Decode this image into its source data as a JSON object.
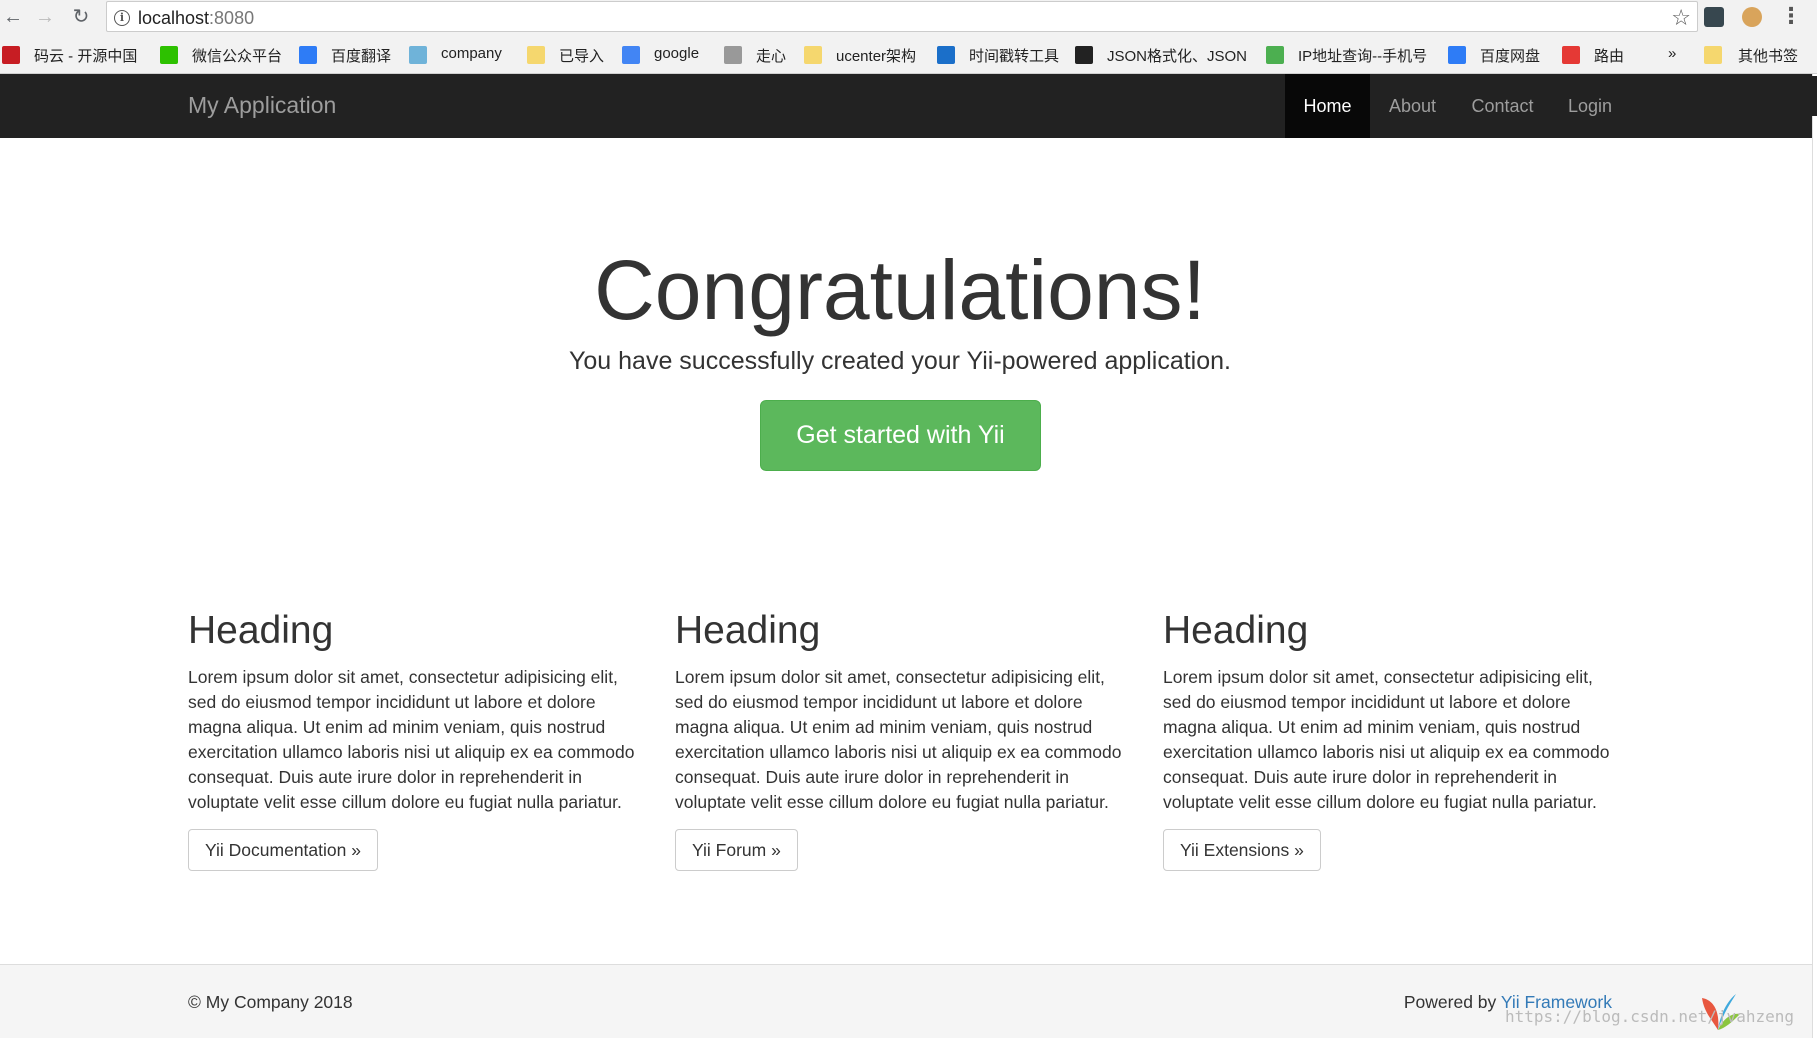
{
  "browser": {
    "url_host": "localhost",
    "url_port": ":8080",
    "bookmarks": [
      {
        "label": "码云 - 开源中国",
        "color": "#c71d23"
      },
      {
        "label": "微信公众平台",
        "color": "#2dc100"
      },
      {
        "label": "百度翻译",
        "color": "#2e7cf6"
      },
      {
        "label": "company",
        "color": "#6fb3d9"
      },
      {
        "label": "已导入",
        "color": "#f5d76e"
      },
      {
        "label": "google",
        "color": "#4285f4"
      },
      {
        "label": "走心",
        "color": "#999999"
      },
      {
        "label": "ucenter架构",
        "color": "#f5d76e"
      },
      {
        "label": "时间戳转工具",
        "color": "#1b6fc9"
      },
      {
        "label": "JSON格式化、JSON",
        "color": "#222222"
      },
      {
        "label": "IP地址查询--手机号",
        "color": "#4caf50"
      },
      {
        "label": "百度网盘",
        "color": "#2e7cf6"
      },
      {
        "label": "路由",
        "color": "#e53935"
      }
    ],
    "overflow_label": "»",
    "other_bookmarks": "其他书签"
  },
  "navbar": {
    "brand": "My Application",
    "links": [
      {
        "label": "Home",
        "active": true
      },
      {
        "label": "About",
        "active": false
      },
      {
        "label": "Contact",
        "active": false
      },
      {
        "label": "Login",
        "active": false
      }
    ]
  },
  "jumbotron": {
    "title": "Congratulations!",
    "lead": "You have successfully created your Yii-powered application.",
    "button": "Get started with Yii"
  },
  "columns": [
    {
      "heading": "Heading",
      "body": "Lorem ipsum dolor sit amet, consectetur adipisicing elit, sed do eiusmod tempor incididunt ut labore et dolore magna aliqua. Ut enim ad minim veniam, quis nostrud exercitation ullamco laboris nisi ut aliquip ex ea commodo consequat. Duis aute irure dolor in reprehenderit in voluptate velit esse cillum dolore eu fugiat nulla pariatur.",
      "button": "Yii Documentation »"
    },
    {
      "heading": "Heading",
      "body": "Lorem ipsum dolor sit amet, consectetur adipisicing elit, sed do eiusmod tempor incididunt ut labore et dolore magna aliqua. Ut enim ad minim veniam, quis nostrud exercitation ullamco laboris nisi ut aliquip ex ea commodo consequat. Duis aute irure dolor in reprehenderit in voluptate velit esse cillum dolore eu fugiat nulla pariatur.",
      "button": "Yii Forum »"
    },
    {
      "heading": "Heading",
      "body": "Lorem ipsum dolor sit amet, consectetur adipisicing elit, sed do eiusmod tempor incididunt ut labore et dolore magna aliqua. Ut enim ad minim veniam, quis nostrud exercitation ullamco laboris nisi ut aliquip ex ea commodo consequat. Duis aute irure dolor in reprehenderit in voluptate velit esse cillum dolore eu fugiat nulla pariatur.",
      "button": "Yii Extensions »"
    }
  ],
  "footer": {
    "copyright": "© My Company 2018",
    "powered_prefix": "Powered by ",
    "powered_link": "Yii Framework"
  },
  "watermark": "https://blog.csdn.net/jvahzeng",
  "colors": {
    "navbar_bg": "#222222",
    "success": "#5cb85c",
    "link": "#337ab7"
  }
}
